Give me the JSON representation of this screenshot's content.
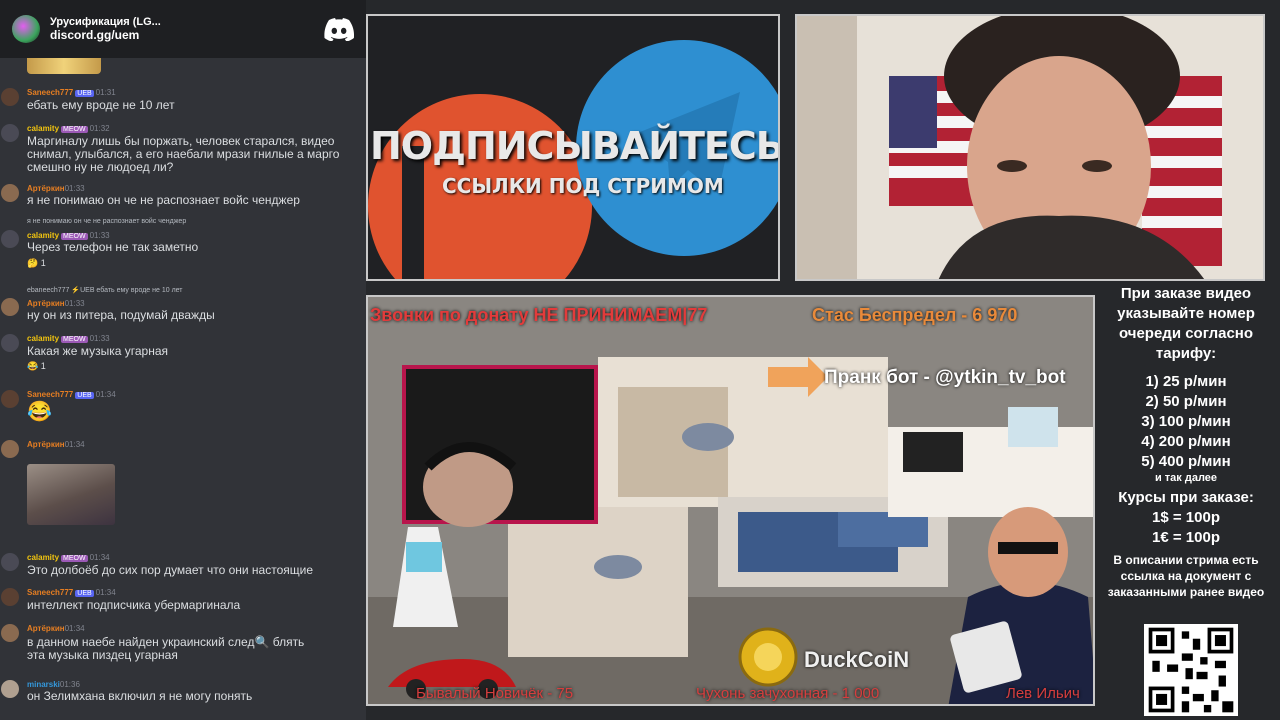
{
  "chat": {
    "server_title": "Урусификация (LG...",
    "server_invite": "discord.gg/uem",
    "messages": [
      {
        "author": "Saneech777",
        "badge": "UEB",
        "time": "01:31",
        "text": "ебать ему вроде не 10 лет",
        "color": "#e67e22"
      },
      {
        "author": "calamity",
        "badge": "MEOW",
        "time": "01:32",
        "text": "Маргиналу лишь бы поржать, человек старался, видео снимал, улыбался, а его наебали мрази гнилые а марго смешно ну не людоед ли?",
        "color": "#f1c40f"
      },
      {
        "author": "Артёркин",
        "badge": "",
        "time": "01:33",
        "text": "я не понимаю он че не распознает войс ченджер",
        "color": "#e67e22"
      },
      {
        "author": "calamity",
        "badge": "MEOW",
        "time": "01:33",
        "text": "Через телефон не так заметно",
        "color": "#f1c40f",
        "reply": "я не понимаю он че не распознает войс ченджер",
        "react": "🤔 1"
      },
      {
        "author": "Артёркин",
        "badge": "",
        "time": "01:33",
        "text": "ну он из питера, подумай дважды",
        "color": "#e67e22",
        "reply": "ebaneech777 ⚡UEB ебать ему вроде не 10 лет"
      },
      {
        "author": "calamity",
        "badge": "MEOW",
        "time": "01:33",
        "text": "Какая же музыка угарная",
        "color": "#f1c40f",
        "react": "😂 1"
      },
      {
        "author": "Saneech777",
        "badge": "UEB",
        "time": "01:34",
        "text": "😂",
        "color": "#e67e22"
      },
      {
        "author": "Артёркин",
        "badge": "",
        "time": "01:34",
        "text": "",
        "color": "#e67e22"
      },
      {
        "author": "calamity",
        "badge": "MEOW",
        "time": "01:34",
        "text": "Это долбоёб до сих пор думает что они настоящие",
        "color": "#f1c40f"
      },
      {
        "author": "Saneech777",
        "badge": "UEB",
        "time": "01:34",
        "text": "интеллект подписчика убермаргинала",
        "color": "#e67e22"
      },
      {
        "author": "Артёркин",
        "badge": "",
        "time": "01:34",
        "text": "в данном наебе найден украинский след🔍 блять эта музыка пиздец угарная",
        "color": "#e67e22"
      },
      {
        "author": "minarski",
        "badge": "",
        "time": "01:36",
        "text": "он Зелимхана включил я не могу понять",
        "color": "#3498db"
      }
    ]
  },
  "promo": {
    "title": "ПОДПИСЫВАЙТЕСЬ",
    "subtitle": "ССЫЛКИ ПОД СТРИМОМ"
  },
  "scene": {
    "donation_calls": "Звонки по донату НЕ ПРИНИМАЕМ|77",
    "top_donor": "Стас Беспредел - 6 970",
    "prank_bot": "Пранк бот - @ytkin_tv_bot",
    "duckcoin": "DuckCoiN",
    "bottom_left": "Бывалый Новичёк - 75",
    "bottom_mid": "Чухонь зачухонная - 1 000",
    "bottom_right": "Лев Ильич"
  },
  "info": {
    "heading": "При заказе видео указывайте номер очереди согласно тарифу:",
    "tariffs": [
      "1) 25 р/мин",
      "2) 50 р/мин",
      "3) 100 р/мин",
      "4) 200 р/мин",
      "5) 400 р/мин"
    ],
    "etc": "и так далее",
    "rates_title": "Курсы при заказе:",
    "rates": [
      "1$ = 100р",
      "1€ = 100р"
    ],
    "description": "В описании стрима есть ссылка на документ с заказанными ранее видео"
  }
}
